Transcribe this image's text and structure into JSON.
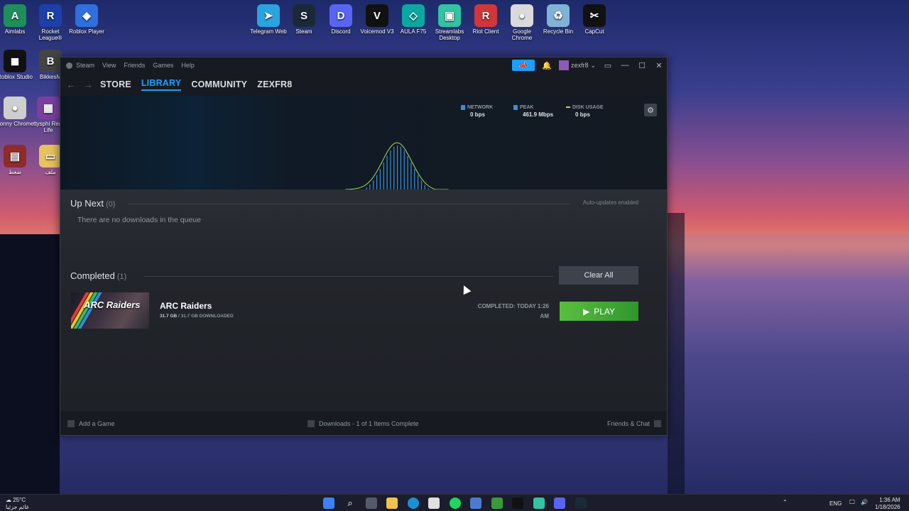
{
  "desktop": {
    "icons": [
      {
        "label": "Aimlabs",
        "color": "#1e8f5a",
        "glyph": "A"
      },
      {
        "label": "Rocket League®",
        "color": "#1c3fa8",
        "glyph": "R"
      },
      {
        "label": "Roblox Player",
        "color": "#2f6fe0",
        "glyph": "◆"
      },
      {
        "label": "Telegram Web",
        "color": "#2aa3df",
        "glyph": "➤"
      },
      {
        "label": "Steam",
        "color": "#1b2838",
        "glyph": "S"
      },
      {
        "label": "Discord",
        "color": "#5865f2",
        "glyph": "D"
      },
      {
        "label": "Voicemod V3",
        "color": "#111111",
        "glyph": "V"
      },
      {
        "label": "AULA F75",
        "color": "#0aa8a0",
        "glyph": "◇"
      },
      {
        "label": "Streamlabs Desktop",
        "color": "#31c3a2",
        "glyph": "▣"
      },
      {
        "label": "Riot Client",
        "color": "#d13639",
        "glyph": "R"
      },
      {
        "label": "Google Chrome",
        "color": "#dadada",
        "glyph": "●"
      },
      {
        "label": "Recycle Bin",
        "color": "#7fb3d5",
        "glyph": "♻"
      },
      {
        "label": "CapCut",
        "color": "#111111",
        "glyph": "✂"
      },
      {
        "label": "Roblox Studio",
        "color": "#111111",
        "glyph": "◼"
      },
      {
        "label": "BikkesM",
        "color": "#444444",
        "glyph": "B"
      },
      {
        "label": "Sonny Chrome",
        "color": "#cfcfcf",
        "glyph": "●"
      },
      {
        "label": "ttysphi Real Life",
        "color": "#7b3fa0",
        "glyph": "▦"
      },
      {
        "label": "ضغط",
        "color": "#8f2b2b",
        "glyph": "▤"
      },
      {
        "label": "ملف",
        "color": "#e6c35c",
        "glyph": "▭"
      }
    ]
  },
  "steam": {
    "menu": [
      "Steam",
      "View",
      "Friends",
      "Games",
      "Help"
    ],
    "username": "zexfr8",
    "tabs": [
      "STORE",
      "LIBRARY",
      "COMMUNITY",
      "ZEXFR8"
    ],
    "active_tab": "LIBRARY",
    "stats": {
      "network_label": "NETWORK",
      "network_value": "0 bps",
      "peak_label": "PEAK",
      "peak_value": "461.9 Mbps",
      "disk_label": "DISK USAGE",
      "disk_value": "0 bps"
    },
    "up_next": {
      "title": "Up Next",
      "count": "(0)",
      "empty_text": "There are no downloads in the queue",
      "auto_updates": "Auto-updates enabled"
    },
    "completed": {
      "title": "Completed",
      "count": "(1)",
      "clear_all": "Clear All"
    },
    "game": {
      "title": "ARC Raiders",
      "thumb_text": "ARC Raiders",
      "size_done": "31.7 GB",
      "size_rest": "/ 31.7 GB DOWNLOADED",
      "completed_line1": "COMPLETED: TODAY 1:26",
      "completed_line2": "AM",
      "play_label": "PLAY"
    },
    "footer": {
      "add_game": "Add a Game",
      "downloads": "Downloads - 1 of 1 Items Complete",
      "friends": "Friends & Chat"
    },
    "colors": {
      "accent": "#1a9fff",
      "play": "#4fb83a",
      "graph_line": "#9ee15a",
      "graph_bar": "#3b8fd6"
    }
  },
  "taskbar": {
    "weather_temp": "25°C",
    "weather_desc": "غائم جزئيا",
    "lang": "ENG",
    "time": "1:36 AM",
    "date": "1/18/2026"
  }
}
